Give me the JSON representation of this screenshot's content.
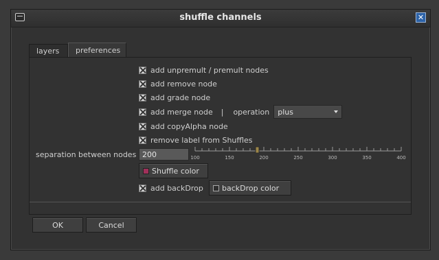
{
  "window": {
    "title": "shuffle channels"
  },
  "tabs": [
    {
      "label": "layers"
    },
    {
      "label": "preferences"
    }
  ],
  "options": [
    {
      "label": "add unpremult / premult nodes",
      "checked": true
    },
    {
      "label": "add remove node",
      "checked": true
    },
    {
      "label": "add grade node",
      "checked": true
    },
    {
      "label": "add merge node",
      "checked": true
    },
    {
      "label": "add copyAlpha node",
      "checked": true
    },
    {
      "label": "remove label from Shuffles",
      "checked": true
    }
  ],
  "merge": {
    "separator": "|",
    "operation_label": "operation",
    "operation_value": "plus"
  },
  "separation": {
    "label": "separation between nodes",
    "value": "200",
    "slider_min": 100,
    "slider_max": 400,
    "slider_value": 190,
    "ticks": [
      "100",
      "150",
      "200",
      "250",
      "300",
      "350",
      "400"
    ]
  },
  "shuffle_color": {
    "label": "Shuffle color",
    "color": "#a0305a"
  },
  "backdrop": {
    "label": "add backDrop",
    "checked": true,
    "color_label": "backDrop color",
    "color": "#2e2e2e"
  },
  "footer": {
    "ok": "OK",
    "cancel": "Cancel"
  },
  "colors": {
    "accent": "#2d63a8",
    "background": "#323232"
  }
}
